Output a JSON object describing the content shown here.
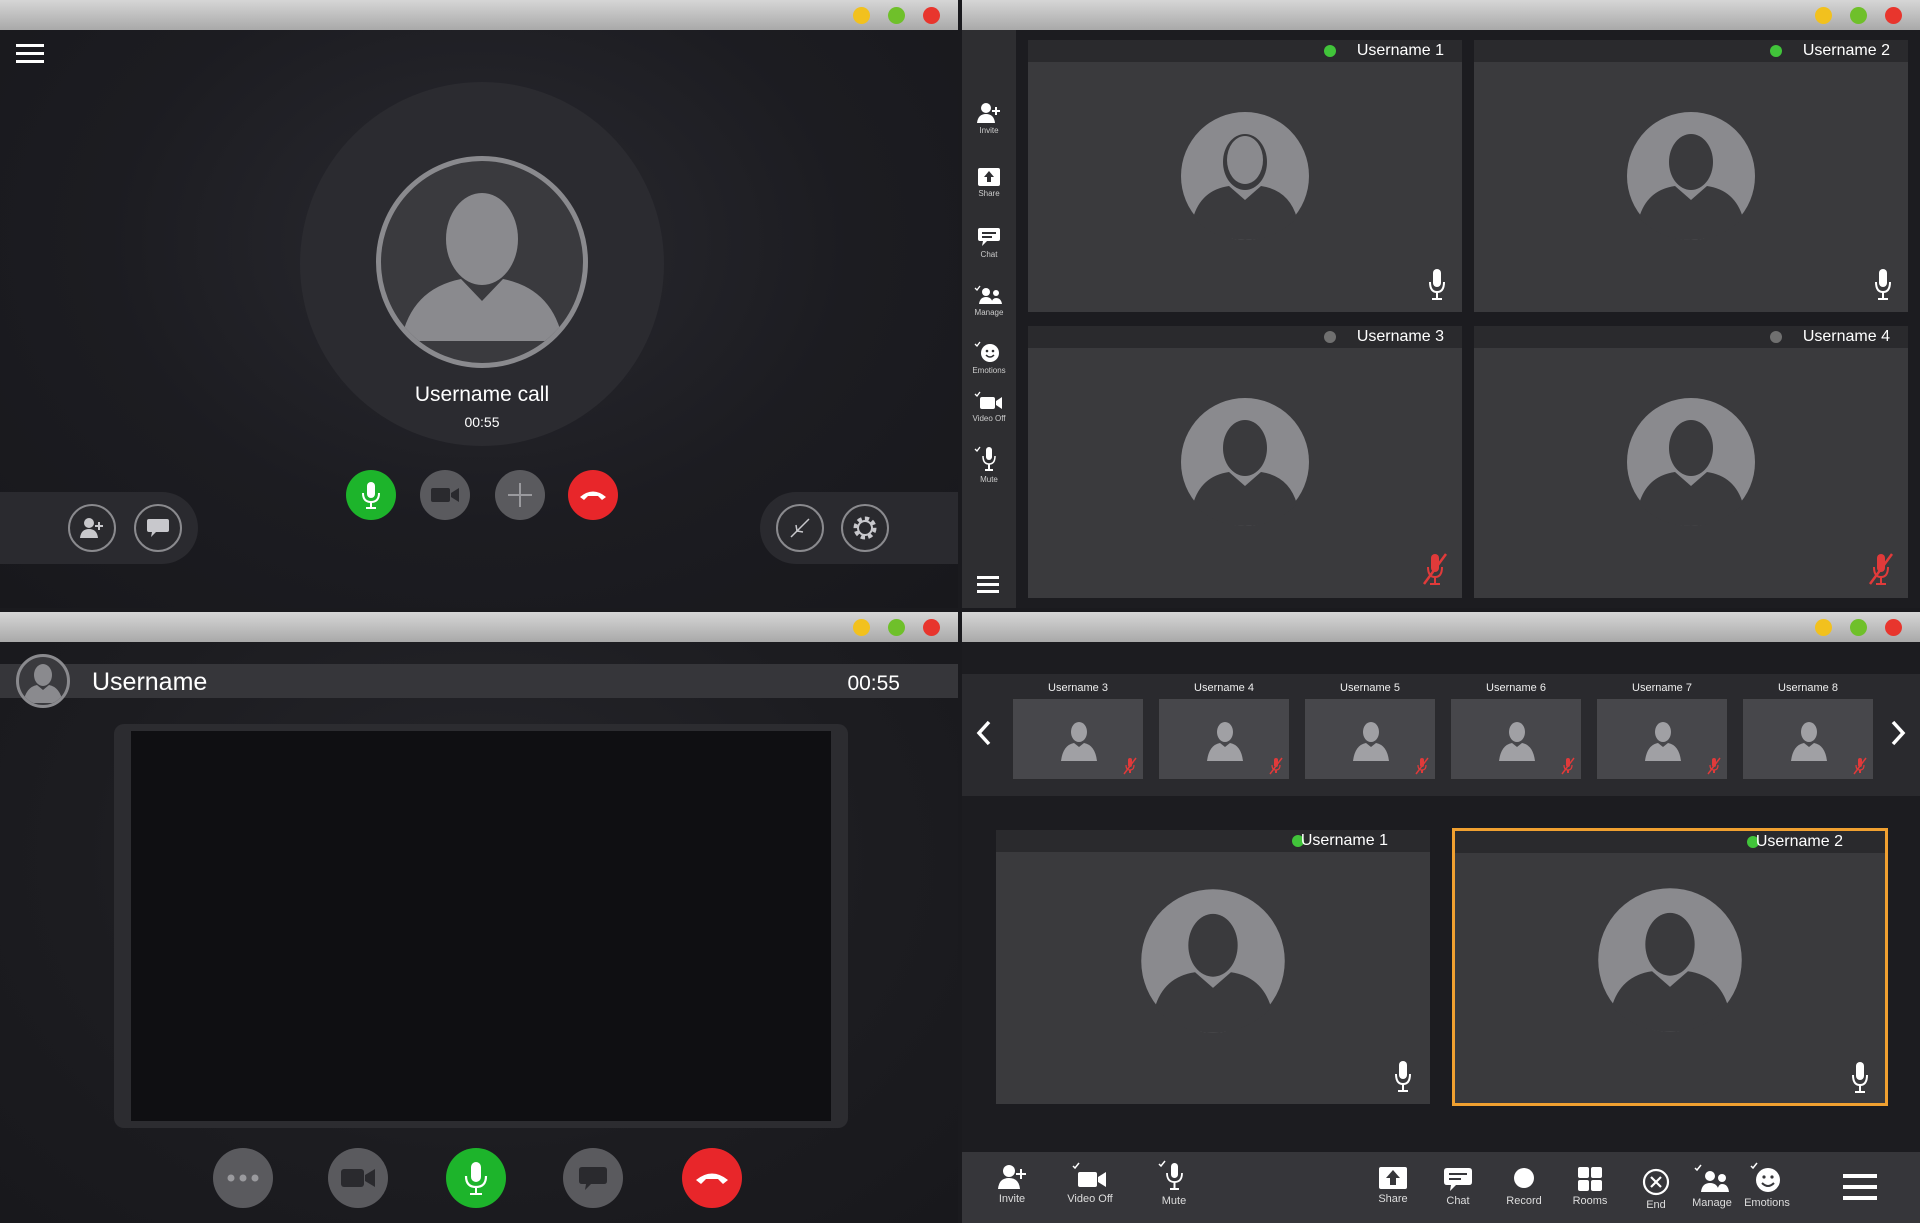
{
  "win1": {
    "caller_name": "Username call",
    "call_timer": "00:55"
  },
  "win2": {
    "sidebar": [
      {
        "label": "Invite",
        "icon": "add-user-icon",
        "check": false
      },
      {
        "label": "Share",
        "icon": "share-icon",
        "check": false
      },
      {
        "label": "Chat",
        "icon": "chat-icon",
        "check": false
      },
      {
        "label": "Manage",
        "icon": "manage-icon",
        "check": true
      },
      {
        "label": "Emotions",
        "icon": "emotions-icon",
        "check": true
      },
      {
        "label": "Video Off",
        "icon": "video-icon",
        "check": true
      },
      {
        "label": "Mute",
        "icon": "mic-icon",
        "check": true
      }
    ],
    "tiles": [
      {
        "name": "Username 1",
        "online": true,
        "muted": false
      },
      {
        "name": "Username 2",
        "online": true,
        "muted": false
      },
      {
        "name": "Username 3",
        "online": false,
        "muted": true
      },
      {
        "name": "Username 4",
        "online": false,
        "muted": true
      }
    ]
  },
  "win3": {
    "username": "Username",
    "timer": "00:55"
  },
  "win4": {
    "thumbnails": [
      "Username 3",
      "Username 4",
      "Username 5",
      "Username 6",
      "Username 7",
      "Username 8"
    ],
    "tiles": [
      {
        "name": "Username 1",
        "online": true,
        "selected": false
      },
      {
        "name": "Username 2",
        "online": true,
        "selected": true
      }
    ],
    "toolbar_left": [
      {
        "label": "Invite",
        "icon": "add-user-icon",
        "check": false
      },
      {
        "label": "Video Off",
        "icon": "video-icon",
        "check": true
      },
      {
        "label": "Mute",
        "icon": "mic-icon",
        "check": true
      }
    ],
    "toolbar_right": [
      {
        "label": "Share",
        "icon": "share-icon",
        "check": false
      },
      {
        "label": "Chat",
        "icon": "chat-icon",
        "check": false
      },
      {
        "label": "Record",
        "icon": "record-icon",
        "check": false
      },
      {
        "label": "Rooms",
        "icon": "rooms-icon",
        "check": false
      },
      {
        "label": "End",
        "icon": "end-icon",
        "check": false
      },
      {
        "label": "Manage",
        "icon": "manage-icon",
        "check": true
      },
      {
        "label": "Emotions",
        "icon": "emotions-icon",
        "check": true
      }
    ]
  },
  "colors": {
    "accent_green": "#1db42b",
    "end_red": "#e8262a",
    "selected_border": "#f0a030",
    "muted_red": "#e03a3a"
  }
}
